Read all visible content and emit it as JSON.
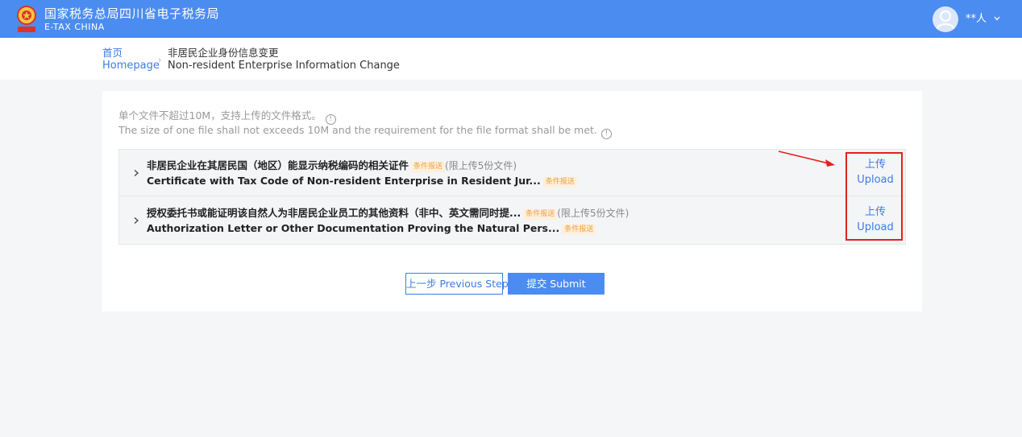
{
  "header": {
    "title_cn": "国家税务总局四川省电子税务局",
    "title_en": "E-TAX  CHINA",
    "logo_icon": "tax-emblem-icon",
    "user_name": "**人",
    "avatar_icon": "user-avatar-icon",
    "dropdown_icon": "chevron-down-icon",
    "colors": {
      "bar": "#4b8cf0"
    }
  },
  "breadcrumb": {
    "home_cn": "首页",
    "home_en": "Homepage",
    "separator": "›",
    "current_cn": "非居民企业身份信息变更",
    "current_en": "Non-resident Enterprise Information Change"
  },
  "notice": {
    "cn": "单个文件不超过10M，支持上传的文件格式。",
    "en": "The size of one file shall not exceeds 10M and the requirement for the file format shall be met.",
    "info_icon": "info-circle-icon",
    "info_glyph": "!"
  },
  "files": [
    {
      "name_cn": "非居民企业在其居民国（地区）能显示纳税编码的相关证件",
      "name_en": "Certificate with Tax Code of Non-resident Enterprise in Resident Jur...",
      "tag_cn": "条件报送",
      "tag_en": "条件报送",
      "limit": "(限上传5份文件)",
      "upload_cn": "上传",
      "upload_en": "Upload"
    },
    {
      "name_cn": "授权委托书或能证明该自然人为非居民企业员工的其他资料（非中、英文需同时提...",
      "name_en": "Authorization Letter or Other Documentation Proving the Natural Pers...",
      "tag_cn": "条件报送",
      "tag_en": "条件报送",
      "limit": "(限上传5份文件)",
      "upload_cn": "上传",
      "upload_en": "Upload"
    }
  ],
  "actions": {
    "prev": "上一步 Previous Step",
    "submit": "提交 Submit"
  },
  "annotation": {
    "color": "#e6201e"
  }
}
